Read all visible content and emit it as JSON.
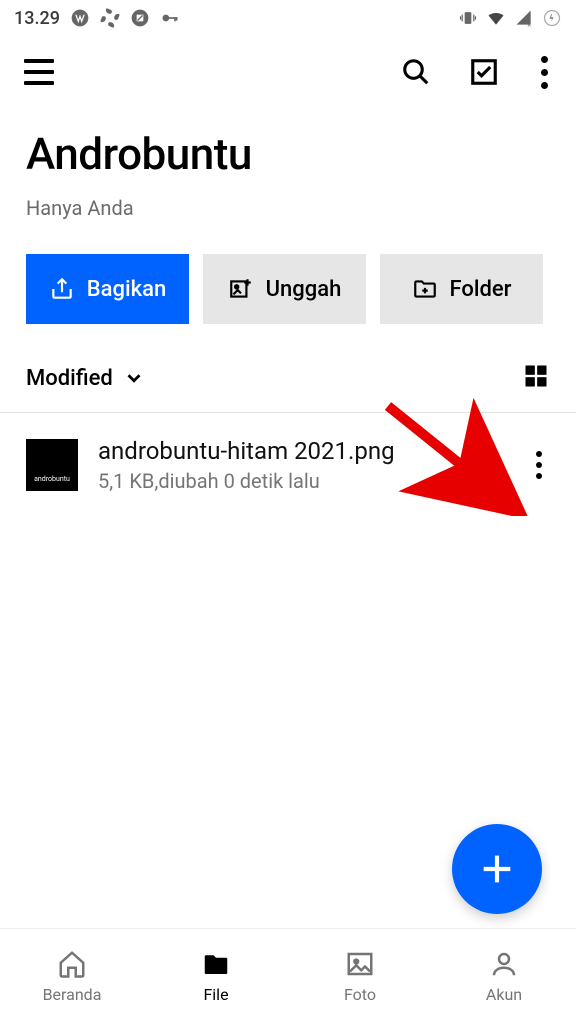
{
  "status": {
    "time": "13.29"
  },
  "header": {
    "title": "Androbuntu",
    "subtitle": "Hanya Anda"
  },
  "actions": {
    "share": "Bagikan",
    "upload": "Unggah",
    "folder": "Folder"
  },
  "sort": {
    "label": "Modified"
  },
  "files": [
    {
      "thumb_text": "androbuntu",
      "name": "androbuntu-hitam 2021.png",
      "meta": "5,1 KB,diubah 0 detik lalu"
    }
  ],
  "nav": {
    "home": "Beranda",
    "file": "File",
    "photo": "Foto",
    "account": "Akun"
  }
}
